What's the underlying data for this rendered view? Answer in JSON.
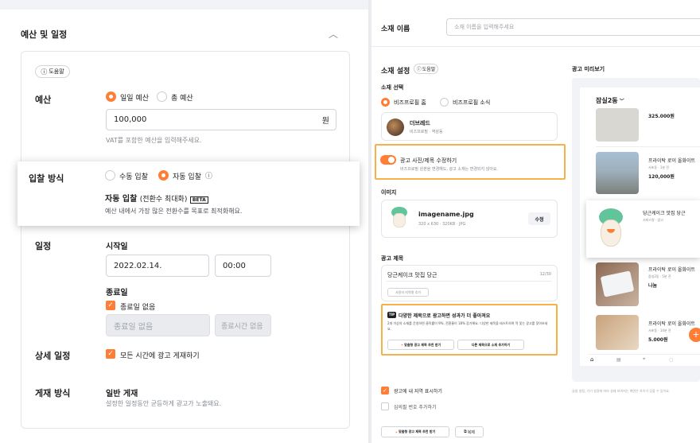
{
  "left": {
    "section_title": "예산 및 일정",
    "help_button": "도움말",
    "budget": {
      "label": "예산",
      "daily": "일일 예산",
      "total": "총 예산",
      "value": "100,000",
      "unit": "원",
      "hint": "VAT를 포함한 예산을 입력해주세요."
    },
    "bidding": {
      "label": "입찰 방식",
      "manual": "수동 입찰",
      "auto": "자동 입찰",
      "auto_title": "자동 입찰",
      "auto_sub": "(전환수 최대화)",
      "beta": "BETA",
      "desc": "예산 내에서 가장 많은 전환수를 목표로 최적화해요."
    },
    "schedule": {
      "label": "일정",
      "start_label": "시작일",
      "start_date": "2022.02.14.",
      "start_time": "00:00",
      "end_label": "종료일",
      "no_end": "종료일 없음",
      "end_date_ph": "종료일 없음",
      "end_time_ph": "종료시간 없음"
    },
    "detail": {
      "label": "상세 일정",
      "all_time": "모든 시간에 광고 게재하기"
    },
    "delivery": {
      "label": "게재 방식",
      "title": "일반 게재",
      "desc": "설정한 일정동안 균등하게 광고가 노출돼요."
    }
  },
  "right": {
    "name_label": "소재 이름",
    "name_placeholder": "소재 이름을 입력해주세요",
    "setting_title": "소재 설정",
    "help_button": "도움말",
    "select_label": "소재 선택",
    "opt_home": "비즈프로필 홈",
    "opt_news": "비즈프로필 소식",
    "profile_name": "더브레드",
    "profile_sub": "비즈프로필 · 역삼동",
    "toggle_title": "광고 사진/제목 수정하기",
    "toggle_desc": "비즈프로필 원본을 변경해도, 광고 소재는 변경되지 않아요.",
    "image_label": "이미지",
    "file_name": "imagename.jpg",
    "file_meta": "320 x 630 · 320KB · JPG",
    "edit_button": "수정",
    "ad_title_label": "광고 제목",
    "ad_title_value": "당근케이크 맛집 당근",
    "char_count": "12/30",
    "used_tag": "사용자 지역명 추가",
    "tip_badge": "TIP",
    "tip_title": "다양한 제목으로 광고하면 성과가 더 좋아져요",
    "tip_desc_1": "2개 이상의 소재를 운영하면 클릭률이 9%, 전환율이 18% 증가해요. 다양한 제목을 테스트하며 딱 맞는 광고를 찾아보세요.",
    "tip_btn_1": "맞춤형 광고 제목 추천 받기",
    "tip_btn_2": "다른 제목으로 소재 추가하기",
    "check_region": "광고에 내 지역 표시하기",
    "check_phone": "심의필 번호 추가하기",
    "bottom_btn_1": "맞춤형 광고 제목 추천 받기",
    "bottom_btn_2": "복제",
    "preview_label": "광고 미리보기",
    "preview_caption": "글꼴 설정, 기기 설정에 따라 실제 보여지는 화면은 차이가 있을 수 있어요.",
    "phone": {
      "location": "잠실2동",
      "items": [
        {
          "title": "",
          "meta": "",
          "price": "325.000원"
        },
        {
          "title": "프라이탁 로이 올화이트",
          "meta": "서초동 · 1분 전",
          "price": "120,000원"
        },
        {
          "title": "당근케이크 맛집 당근",
          "meta": "서비스명 · 광고",
          "price": ""
        },
        {
          "title": "프라이탁 로이 올화이트",
          "meta": "잠실2동 · 5분 전",
          "price": "나눔"
        },
        {
          "title": "프라이탁 로이 올화이트",
          "meta": "서초동 · 14분 전",
          "price": "5.000원"
        }
      ],
      "nav": [
        "홈",
        "동네생활",
        "동네지도",
        "채팅"
      ]
    }
  }
}
